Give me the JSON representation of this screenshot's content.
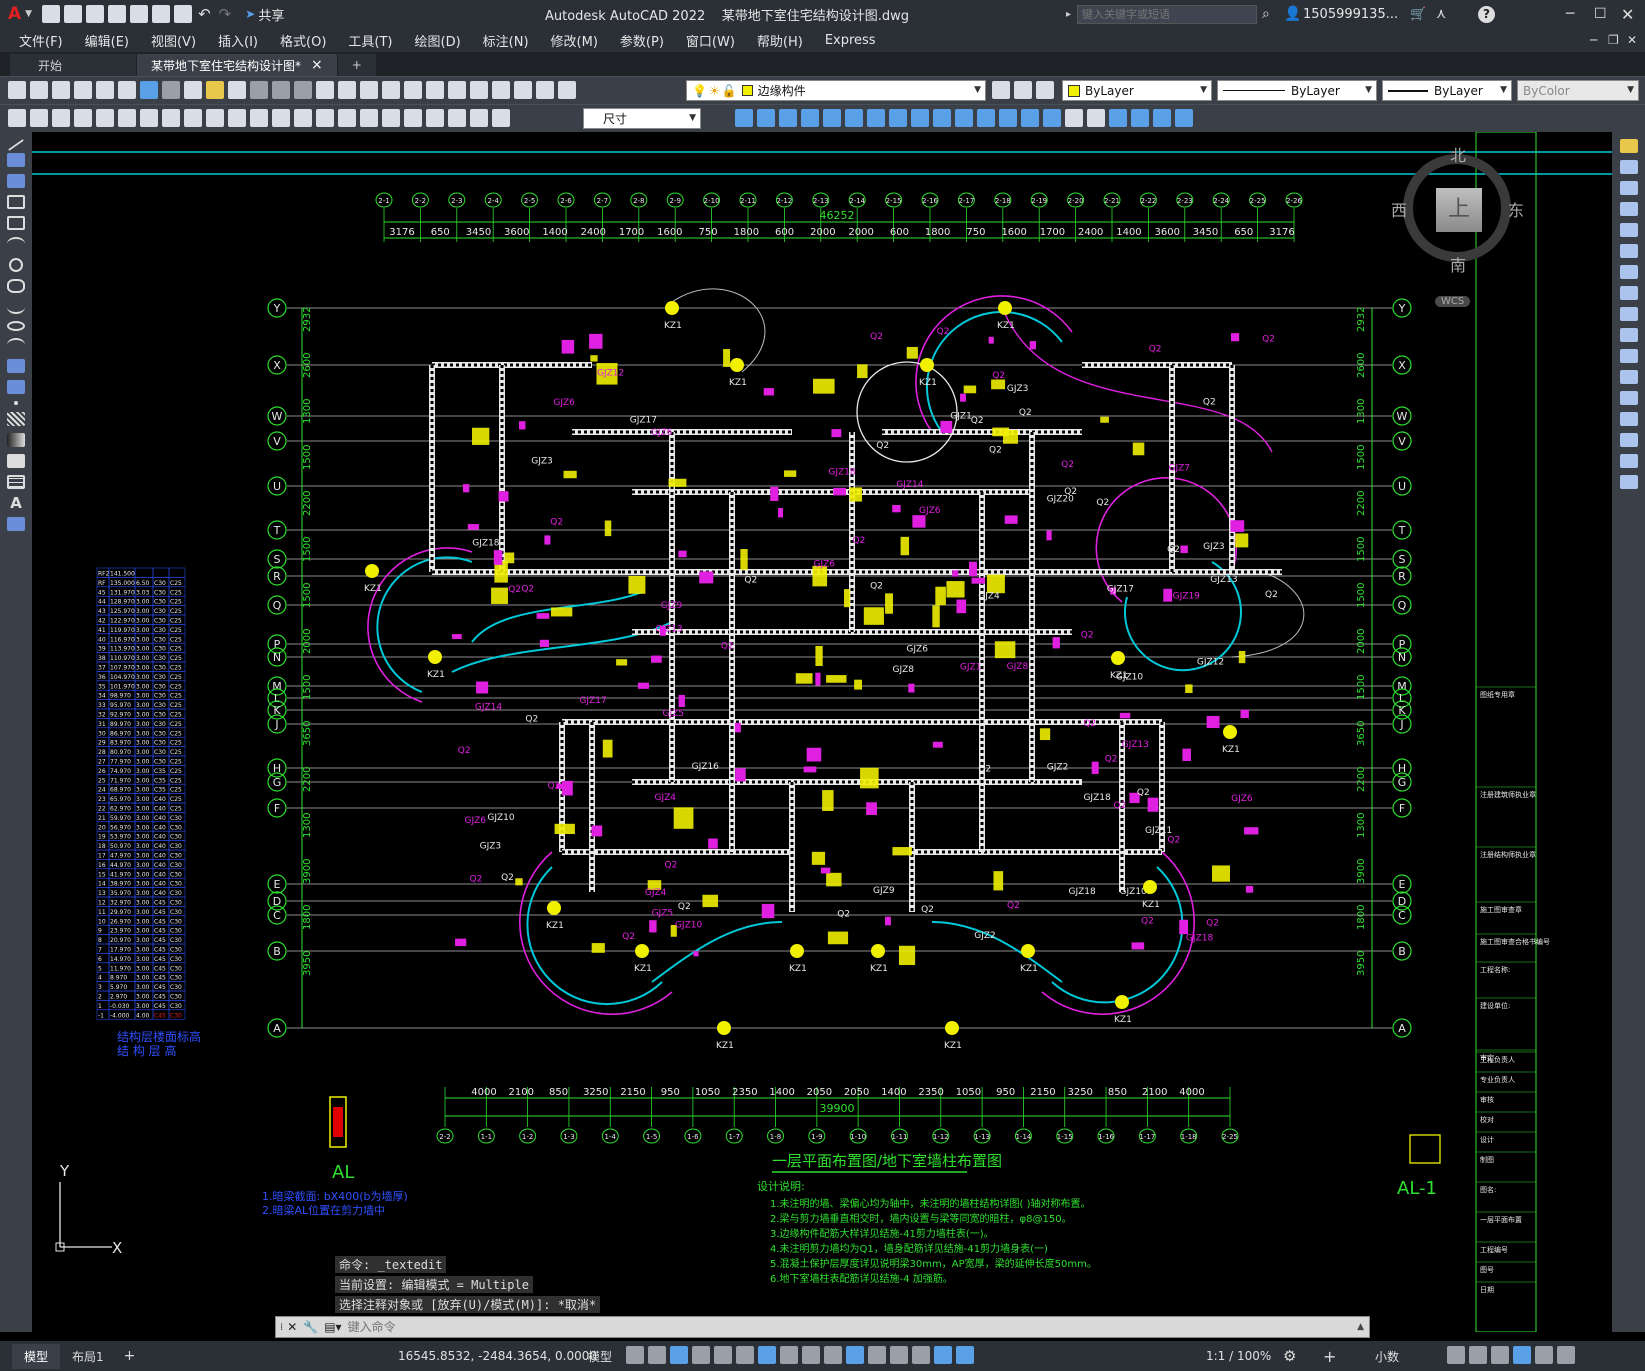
{
  "titlebar": {
    "app_logo": "A",
    "share": "共享",
    "title": "Autodesk AutoCAD 2022    某带地下室住宅结构设计图.dwg",
    "search_placeholder": "键入关键字或短语",
    "user": "1505999135...",
    "help": "?"
  },
  "menu": [
    "文件(F)",
    "编辑(E)",
    "视图(V)",
    "插入(I)",
    "格式(O)",
    "工具(T)",
    "绘图(D)",
    "标注(N)",
    "修改(M)",
    "参数(P)",
    "窗口(W)",
    "帮助(H)",
    "Express"
  ],
  "tabs": {
    "start": "开始",
    "doc": "某带地下室住宅结构设计图*",
    "close": "×",
    "add": "+"
  },
  "toolbar": {
    "layer": "边缘构件",
    "color": "ByLayer",
    "linetype": "ByLayer",
    "lineweight": "ByLayer",
    "plotstyle": "ByColor",
    "dimstyle": "尺寸"
  },
  "viewcube": {
    "north": "北",
    "south": "南",
    "east": "东",
    "west": "西",
    "top": "上",
    "wcs": "WCS"
  },
  "drawing": {
    "plan_title": "一层平面布置图/地下室墙柱布置图",
    "top_dim_total": "46252",
    "bottom_dim_total": "39900",
    "top_dims": [
      "3176",
      "650",
      "3450",
      "3600",
      "1400",
      "2400",
      "1700",
      "1600",
      "750",
      "1800",
      "600",
      "2000",
      "2000",
      "600",
      "1800",
      "750",
      "1600",
      "1700",
      "2400",
      "1400",
      "3600",
      "3450",
      "650",
      "3176"
    ],
    "bottom_dims": [
      "4000",
      "2100",
      "850",
      "3250",
      "2150",
      "950",
      "1050",
      "2350",
      "1400",
      "2050",
      "2050",
      "1400",
      "2350",
      "1050",
      "950",
      "2150",
      "3250",
      "850",
      "2100",
      "4000"
    ],
    "top_axes": [
      "2-1",
      "2-2",
      "2-3",
      "2-4",
      "2-5",
      "2-6",
      "2-7",
      "2-8",
      "2-9",
      "2-10",
      "2-11",
      "2-12",
      "2-13",
      "2-14",
      "2-15",
      "2-16",
      "2-17",
      "2-18",
      "2-19",
      "2-20",
      "2-21",
      "2-22",
      "2-23",
      "2-24",
      "2-25",
      "2-26"
    ],
    "bottom_axes": [
      "2-2",
      "1-1",
      "1-2",
      "1-3",
      "1-4",
      "1-5",
      "1-6",
      "1-7",
      "1-8",
      "1-9",
      "1-10",
      "1-11",
      "1-12",
      "1-13",
      "1-14",
      "1-15",
      "1-16",
      "1-17",
      "1-18",
      "2-25"
    ],
    "row_axes": [
      "Y",
      "X",
      "W",
      "V",
      "U",
      "T",
      "S",
      "R",
      "Q",
      "P",
      "N",
      "M",
      "L",
      "K",
      "J",
      "H",
      "G",
      "F",
      "E",
      "D",
      "C",
      "B",
      "A"
    ],
    "left_dims": [
      "2932",
      "2600",
      "1300",
      "1500",
      "2200",
      "1500",
      "1500",
      "2000",
      "1500",
      "3650",
      "2200",
      "1300",
      "3900",
      "1800",
      "3950"
    ],
    "section_al": "AL",
    "section_al1": "AL-1",
    "notes_title": "设计说明:",
    "notes": [
      "1.未注明的墙、梁偏心均为轴中，未注明的墙柱结构详图(  )轴对称布置。",
      "2.梁与剪力墙垂直相交时，墙内设置与梁等同宽的暗柱，φ8@150。",
      "3.边缘构件配筋大样详见结施-41剪力墙柱表(一)。",
      "4.未注明剪力墙均为Q1，墙身配筋详见结施-41剪力墙身表(一)",
      "5.混凝土保护层厚度详见说明梁30mm，AP宽厚，梁的延伸长度50mm。",
      "6.地下室墙柱表配筋详见结施-4 加强筋。"
    ],
    "al_notes": [
      "1.暗梁截面: bX400(b为墙厚)",
      "2.暗梁AL位置在剪力墙中"
    ],
    "floor_table_title": [
      "结构层楼面标高",
      "结 构 层 高"
    ],
    "floor_rows": [
      [
        "RF2",
        "141.500",
        "",
        "",
        ""
      ],
      [
        "RF",
        "135.000",
        "6.50",
        "C30",
        "C25"
      ],
      [
        "45",
        "131.970",
        "3.03",
        "C30",
        "C25"
      ],
      [
        "44",
        "128.970",
        "3.00",
        "C30",
        "C25"
      ],
      [
        "43",
        "125.970",
        "3.00",
        "C30",
        "C25"
      ],
      [
        "42",
        "122.970",
        "3.00",
        "C30",
        "C25"
      ],
      [
        "41",
        "119.970",
        "3.00",
        "C30",
        "C25"
      ],
      [
        "40",
        "116.970",
        "3.00",
        "C30",
        "C25"
      ],
      [
        "39",
        "113.970",
        "3.00",
        "C30",
        "C25"
      ],
      [
        "38",
        "110.970",
        "3.00",
        "C30",
        "C25"
      ],
      [
        "37",
        "107.970",
        "3.00",
        "C30",
        "C25"
      ],
      [
        "36",
        "104.970",
        "3.00",
        "C30",
        "C25"
      ],
      [
        "35",
        "101.970",
        "3.00",
        "C30",
        "C25"
      ],
      [
        "34",
        "98.970",
        "3.00",
        "C30",
        "C25"
      ],
      [
        "33",
        "95.970",
        "3.00",
        "C30",
        "C25"
      ],
      [
        "32",
        "92.970",
        "3.00",
        "C30",
        "C25"
      ],
      [
        "31",
        "89.970",
        "3.00",
        "C30",
        "C25"
      ],
      [
        "30",
        "86.970",
        "3.00",
        "C30",
        "C25"
      ],
      [
        "29",
        "83.970",
        "3.00",
        "C30",
        "C25"
      ],
      [
        "28",
        "80.970",
        "3.00",
        "C30",
        "C25"
      ],
      [
        "27",
        "77.970",
        "3.00",
        "C30",
        "C25"
      ],
      [
        "26",
        "74.970",
        "3.00",
        "C35",
        "C25"
      ],
      [
        "25",
        "71.970",
        "3.00",
        "C35",
        "C25"
      ],
      [
        "24",
        "68.970",
        "3.00",
        "C35",
        "C25"
      ],
      [
        "23",
        "65.970",
        "3.00",
        "C40",
        "C25"
      ],
      [
        "22",
        "62.970",
        "3.00",
        "C40",
        "C25"
      ],
      [
        "21",
        "59.970",
        "3.00",
        "C40",
        "C30"
      ],
      [
        "20",
        "56.970",
        "3.00",
        "C40",
        "C30"
      ],
      [
        "19",
        "53.970",
        "3.00",
        "C40",
        "C30"
      ],
      [
        "18",
        "50.970",
        "3.00",
        "C40",
        "C30"
      ],
      [
        "17",
        "47.970",
        "3.00",
        "C40",
        "C30"
      ],
      [
        "16",
        "44.970",
        "3.00",
        "C40",
        "C30"
      ],
      [
        "15",
        "41.970",
        "3.00",
        "C40",
        "C30"
      ],
      [
        "14",
        "38.970",
        "3.00",
        "C40",
        "C30"
      ],
      [
        "13",
        "35.970",
        "3.00",
        "C40",
        "C30"
      ],
      [
        "12",
        "32.970",
        "3.00",
        "C45",
        "C30"
      ],
      [
        "11",
        "29.970",
        "3.00",
        "C45",
        "C30"
      ],
      [
        "10",
        "26.970",
        "3.00",
        "C45",
        "C30"
      ],
      [
        "9",
        "23.970",
        "3.00",
        "C45",
        "C30"
      ],
      [
        "8",
        "20.970",
        "3.00",
        "C45",
        "C30"
      ],
      [
        "7",
        "17.970",
        "3.00",
        "C45",
        "C30"
      ],
      [
        "6",
        "14.970",
        "3.00",
        "C45",
        "C30"
      ],
      [
        "5",
        "11.970",
        "3.00",
        "C45",
        "C30"
      ],
      [
        "4",
        "8.970",
        "3.00",
        "C45",
        "C30"
      ],
      [
        "3",
        "5.970",
        "3.00",
        "C45",
        "C30"
      ],
      [
        "2",
        "2.970",
        "3.00",
        "C45",
        "C30"
      ],
      [
        "1",
        "-0.030",
        "3.00",
        "C45",
        "C30"
      ],
      [
        "-1",
        "-4.000",
        "4.00",
        "C45",
        "C30"
      ]
    ],
    "right_panel_labels": [
      "图纸专用章",
      "注册建筑师执业章",
      "注册结构师执业章",
      "施工图审查章",
      "施工图审查合格书编号",
      "工程名称:",
      "建设单位:",
      "审定",
      "工程负责人",
      "专业负责人",
      "审核",
      "校对",
      "设计",
      "制图",
      "图名:",
      "一层平面布置",
      "工程编号",
      "图号",
      "日期"
    ],
    "ucs_x": "X",
    "ucs_y": "Y"
  },
  "command": {
    "history": [
      "命令: _textedit",
      "当前设置: 编辑模式 = Multiple",
      "选择注释对象或 [放弃(U)/模式(M)]: *取消*"
    ],
    "placeholder": "键入命令"
  },
  "status": {
    "layout_tabs": [
      "模型",
      "布局1"
    ],
    "add_layout": "+",
    "coords": "16545.8532, -2484.3654, 0.0000",
    "model": "模型",
    "scale": "1:1 / 100%",
    "units": "小数"
  },
  "colors": {
    "green": "#2fe02f",
    "magenta": "#e020e0",
    "yellow": "#f0f000",
    "cyan": "#00c8d8",
    "white": "#e8e8e8",
    "blue": "#3050ff"
  }
}
